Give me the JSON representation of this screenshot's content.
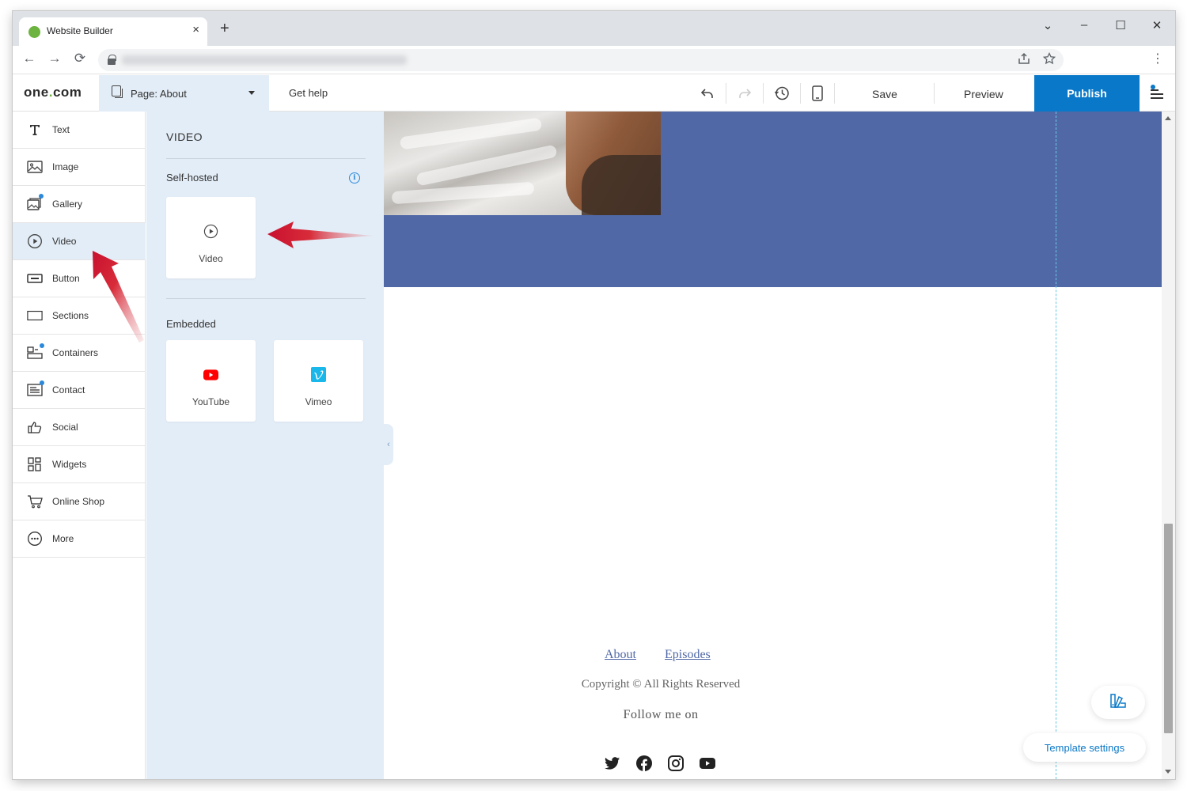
{
  "browser": {
    "tab_title": "Website Builder",
    "tab_close": "×",
    "new_tab": "+",
    "window_controls": [
      "⌄",
      "–",
      "☐",
      "✕"
    ],
    "nav": {
      "back": "←",
      "forward": "→",
      "reload": "⟳"
    },
    "favicon_color": "#6cb33f"
  },
  "topbar": {
    "logo_prefix": "one",
    "logo_dot": ".",
    "logo_suffix": "com",
    "page_prefix": "Page:",
    "page_name": "About",
    "get_help": "Get help",
    "save": "Save",
    "preview": "Preview",
    "publish": "Publish",
    "accent_color": "#0a78c8"
  },
  "sidebar": {
    "items": [
      {
        "label": "Text",
        "icon": "text-icon"
      },
      {
        "label": "Image",
        "icon": "image-icon"
      },
      {
        "label": "Gallery",
        "icon": "gallery-icon"
      },
      {
        "label": "Video",
        "icon": "video-play-icon",
        "active": true
      },
      {
        "label": "Button",
        "icon": "button-icon"
      },
      {
        "label": "Sections",
        "icon": "sections-icon"
      },
      {
        "label": "Containers",
        "icon": "containers-icon"
      },
      {
        "label": "Contact",
        "icon": "contact-form-icon"
      },
      {
        "label": "Social",
        "icon": "thumbs-up-icon"
      },
      {
        "label": "Widgets",
        "icon": "widgets-icon"
      },
      {
        "label": "Online Shop",
        "icon": "cart-icon"
      },
      {
        "label": "More",
        "icon": "more-dots-icon"
      }
    ]
  },
  "panel": {
    "title": "VIDEO",
    "self_hosted_heading": "Self-hosted",
    "info": "i",
    "self_hosted_items": [
      {
        "label": "Video",
        "icon": "video-play-icon"
      }
    ],
    "embedded_heading": "Embedded",
    "embedded_items": [
      {
        "label": "YouTube",
        "icon": "youtube-icon",
        "color": "#ff0000"
      },
      {
        "label": "Vimeo",
        "icon": "vimeo-icon",
        "color": "#1ab7ea"
      }
    ],
    "collapse": "‹"
  },
  "canvas": {
    "band_color": "#5068a6",
    "footer_links": [
      "About",
      "Episodes"
    ],
    "copyright": "Copyright © All Rights Reserved",
    "follow": "Follow me on",
    "social_icons": [
      "twitter-icon",
      "facebook-icon",
      "instagram-icon",
      "youtube-icon"
    ],
    "template_settings": "Template settings"
  }
}
